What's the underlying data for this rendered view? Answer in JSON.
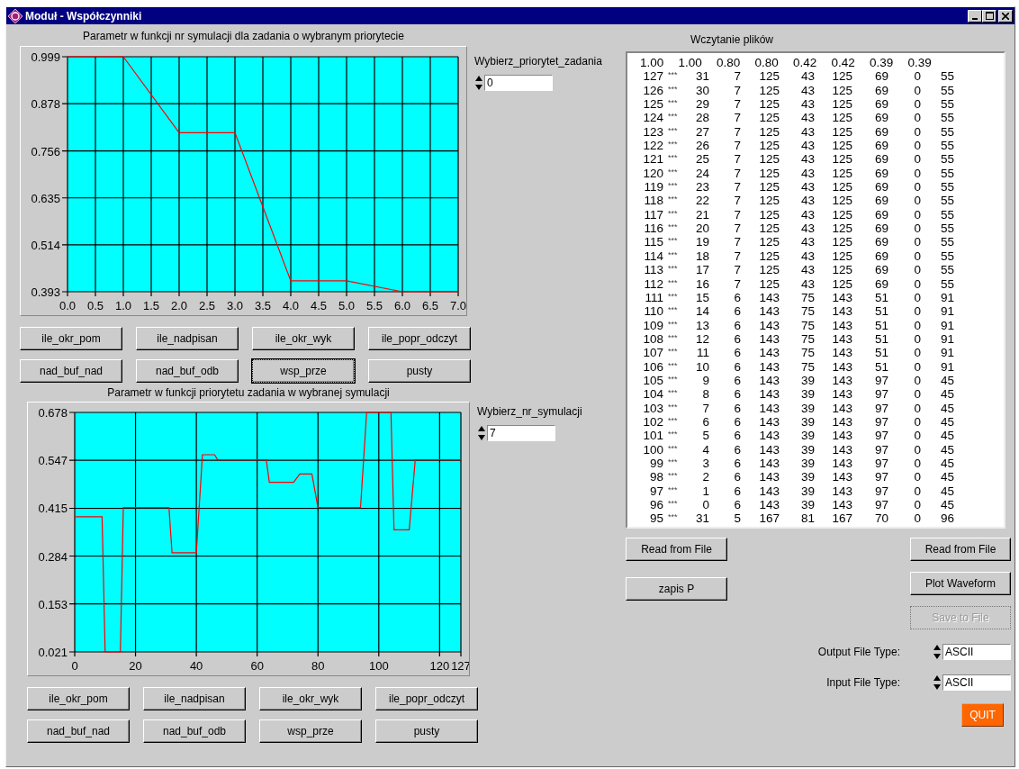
{
  "window": {
    "title": "Moduł - Współczynniki"
  },
  "plots": [
    {
      "title": "Parametr w funkcji nr symulacji dla zadania o wybranym priorytecie",
      "chart_data": {
        "type": "line",
        "x": [
          0,
          1,
          2,
          3,
          4,
          5,
          6,
          7
        ],
        "grid": true,
        "series": [
          {
            "color": "#ff0000",
            "values": [
              0.999,
              0.999,
              0.803,
              0.803,
              0.421,
              0.421,
              0.393,
              0.393
            ]
          }
        ],
        "xlim": [
          0,
          7
        ],
        "ylim": [
          0.393,
          0.999
        ],
        "xticks": [
          {
            "value": 0,
            "label": "0.0"
          },
          {
            "value": 0.5,
            "label": "0.5"
          },
          {
            "value": 1,
            "label": "1.0"
          },
          {
            "value": 1.5,
            "label": "1.5"
          },
          {
            "value": 2,
            "label": "2.0"
          },
          {
            "value": 2.5,
            "label": "2.5"
          },
          {
            "value": 3,
            "label": "3.0"
          },
          {
            "value": 3.5,
            "label": "3.5"
          },
          {
            "value": 4,
            "label": "4.0"
          },
          {
            "value": 4.5,
            "label": "4.5"
          },
          {
            "value": 5,
            "label": "5.0"
          },
          {
            "value": 5.5,
            "label": "5.5"
          },
          {
            "value": 6,
            "label": "6.0"
          },
          {
            "value": 6.5,
            "label": "6.5"
          },
          {
            "value": 7,
            "label": "7.0"
          }
        ],
        "yticks": [
          {
            "value": 0.393,
            "label": "0.393"
          },
          {
            "value": 0.514,
            "label": "0.514"
          },
          {
            "value": 0.635,
            "label": "0.635"
          },
          {
            "value": 0.756,
            "label": "0.756"
          },
          {
            "value": 0.878,
            "label": "0.878"
          },
          {
            "value": 0.999,
            "label": "0.999"
          }
        ]
      },
      "selector": {
        "label": "Wybierz_priorytet_zadania",
        "value": "0"
      },
      "buttons": [
        {
          "label": "ile_okr_pom",
          "focused": false
        },
        {
          "label": "ile_nadpisan",
          "focused": false
        },
        {
          "label": "ile_okr_wyk",
          "focused": false
        },
        {
          "label": "ile_popr_odczyt",
          "focused": false
        },
        {
          "label": "nad_buf_nad",
          "focused": false
        },
        {
          "label": "nad_buf_odb",
          "focused": false
        },
        {
          "label": "wsp_prze",
          "focused": true
        },
        {
          "label": "pusty",
          "focused": false
        }
      ]
    },
    {
      "title": "Parametr w funkcji priorytetu zadania w wybranej symulacji",
      "chart_data": {
        "type": "line",
        "x": [
          0,
          9,
          10,
          15,
          16,
          31,
          32,
          40,
          42,
          46,
          47,
          63,
          64,
          72,
          74,
          78,
          80,
          94,
          96,
          104,
          105,
          110,
          112,
          127
        ],
        "grid": true,
        "series": [
          {
            "color": "#ff0000",
            "values": [
              0.392,
              0.392,
              0.021,
              0.021,
              0.417,
              0.417,
              0.293,
              0.293,
              0.562,
              0.562,
              0.548,
              0.548,
              0.486,
              0.486,
              0.509,
              0.509,
              0.417,
              0.417,
              0.678,
              0.678,
              0.356,
              0.356,
              0.548,
              0.548
            ]
          }
        ],
        "xlim": [
          0,
          127
        ],
        "ylim": [
          0.021,
          0.678
        ],
        "xticks": [
          {
            "value": 0,
            "label": "0"
          },
          {
            "value": 20,
            "label": "20"
          },
          {
            "value": 40,
            "label": "40"
          },
          {
            "value": 60,
            "label": "60"
          },
          {
            "value": 80,
            "label": "80"
          },
          {
            "value": 100,
            "label": "100"
          },
          {
            "value": 120,
            "label": "120"
          },
          {
            "value": 127,
            "label": "127"
          }
        ],
        "yticks": [
          {
            "value": 0.021,
            "label": "0.021"
          },
          {
            "value": 0.153,
            "label": "0.153"
          },
          {
            "value": 0.284,
            "label": "0.284"
          },
          {
            "value": 0.415,
            "label": "0.415"
          },
          {
            "value": 0.547,
            "label": "0.547"
          },
          {
            "value": 0.678,
            "label": "0.678"
          }
        ]
      },
      "selector": {
        "label": "Wybierz_nr_symulacji",
        "value": "7"
      },
      "buttons": [
        {
          "label": "ile_okr_pom",
          "focused": false
        },
        {
          "label": "ile_nadpisan",
          "focused": false
        },
        {
          "label": "ile_okr_wyk",
          "focused": false
        },
        {
          "label": "ile_popr_odczyt",
          "focused": false
        },
        {
          "label": "nad_buf_nad",
          "focused": false
        },
        {
          "label": "nad_buf_odb",
          "focused": false
        },
        {
          "label": "wsp_prze",
          "focused": false
        },
        {
          "label": "pusty",
          "focused": false
        }
      ]
    }
  ],
  "file_list": {
    "title": "Wczytanie plików",
    "header": [
      "1.00",
      "1.00",
      "0.80",
      "0.80",
      "0.42",
      "0.42",
      "0.39",
      "0.39"
    ],
    "rows": [
      {
        "id": "127",
        "marker": "***",
        "cells": [
          "31",
          "7",
          "125",
          "43",
          "125",
          "69",
          "0",
          "55"
        ]
      },
      {
        "id": "126",
        "marker": "***",
        "cells": [
          "30",
          "7",
          "125",
          "43",
          "125",
          "69",
          "0",
          "55"
        ]
      },
      {
        "id": "125",
        "marker": "***",
        "cells": [
          "29",
          "7",
          "125",
          "43",
          "125",
          "69",
          "0",
          "55"
        ]
      },
      {
        "id": "124",
        "marker": "***",
        "cells": [
          "28",
          "7",
          "125",
          "43",
          "125",
          "69",
          "0",
          "55"
        ]
      },
      {
        "id": "123",
        "marker": "***",
        "cells": [
          "27",
          "7",
          "125",
          "43",
          "125",
          "69",
          "0",
          "55"
        ]
      },
      {
        "id": "122",
        "marker": "***",
        "cells": [
          "26",
          "7",
          "125",
          "43",
          "125",
          "69",
          "0",
          "55"
        ]
      },
      {
        "id": "121",
        "marker": "***",
        "cells": [
          "25",
          "7",
          "125",
          "43",
          "125",
          "69",
          "0",
          "55"
        ]
      },
      {
        "id": "120",
        "marker": "***",
        "cells": [
          "24",
          "7",
          "125",
          "43",
          "125",
          "69",
          "0",
          "55"
        ]
      },
      {
        "id": "119",
        "marker": "***",
        "cells": [
          "23",
          "7",
          "125",
          "43",
          "125",
          "69",
          "0",
          "55"
        ]
      },
      {
        "id": "118",
        "marker": "***",
        "cells": [
          "22",
          "7",
          "125",
          "43",
          "125",
          "69",
          "0",
          "55"
        ]
      },
      {
        "id": "117",
        "marker": "***",
        "cells": [
          "21",
          "7",
          "125",
          "43",
          "125",
          "69",
          "0",
          "55"
        ]
      },
      {
        "id": "116",
        "marker": "***",
        "cells": [
          "20",
          "7",
          "125",
          "43",
          "125",
          "69",
          "0",
          "55"
        ]
      },
      {
        "id": "115",
        "marker": "***",
        "cells": [
          "19",
          "7",
          "125",
          "43",
          "125",
          "69",
          "0",
          "55"
        ]
      },
      {
        "id": "114",
        "marker": "***",
        "cells": [
          "18",
          "7",
          "125",
          "43",
          "125",
          "69",
          "0",
          "55"
        ]
      },
      {
        "id": "113",
        "marker": "***",
        "cells": [
          "17",
          "7",
          "125",
          "43",
          "125",
          "69",
          "0",
          "55"
        ]
      },
      {
        "id": "112",
        "marker": "***",
        "cells": [
          "16",
          "7",
          "125",
          "43",
          "125",
          "69",
          "0",
          "55"
        ]
      },
      {
        "id": "111",
        "marker": "***",
        "cells": [
          "15",
          "6",
          "143",
          "75",
          "143",
          "51",
          "0",
          "91"
        ]
      },
      {
        "id": "110",
        "marker": "***",
        "cells": [
          "14",
          "6",
          "143",
          "75",
          "143",
          "51",
          "0",
          "91"
        ]
      },
      {
        "id": "109",
        "marker": "***",
        "cells": [
          "13",
          "6",
          "143",
          "75",
          "143",
          "51",
          "0",
          "91"
        ]
      },
      {
        "id": "108",
        "marker": "***",
        "cells": [
          "12",
          "6",
          "143",
          "75",
          "143",
          "51",
          "0",
          "91"
        ]
      },
      {
        "id": "107",
        "marker": "***",
        "cells": [
          "11",
          "6",
          "143",
          "75",
          "143",
          "51",
          "0",
          "91"
        ]
      },
      {
        "id": "106",
        "marker": "***",
        "cells": [
          "10",
          "6",
          "143",
          "75",
          "143",
          "51",
          "0",
          "91"
        ]
      },
      {
        "id": "105",
        "marker": "***",
        "cells": [
          "9",
          "6",
          "143",
          "39",
          "143",
          "97",
          "0",
          "45"
        ]
      },
      {
        "id": "104",
        "marker": "***",
        "cells": [
          "8",
          "6",
          "143",
          "39",
          "143",
          "97",
          "0",
          "45"
        ]
      },
      {
        "id": "103",
        "marker": "***",
        "cells": [
          "7",
          "6",
          "143",
          "39",
          "143",
          "97",
          "0",
          "45"
        ]
      },
      {
        "id": "102",
        "marker": "***",
        "cells": [
          "6",
          "6",
          "143",
          "39",
          "143",
          "97",
          "0",
          "45"
        ]
      },
      {
        "id": "101",
        "marker": "***",
        "cells": [
          "5",
          "6",
          "143",
          "39",
          "143",
          "97",
          "0",
          "45"
        ]
      },
      {
        "id": "100",
        "marker": "***",
        "cells": [
          "4",
          "6",
          "143",
          "39",
          "143",
          "97",
          "0",
          "45"
        ]
      },
      {
        "id": "99",
        "marker": "***",
        "cells": [
          "3",
          "6",
          "143",
          "39",
          "143",
          "97",
          "0",
          "45"
        ]
      },
      {
        "id": "98",
        "marker": "***",
        "cells": [
          "2",
          "6",
          "143",
          "39",
          "143",
          "97",
          "0",
          "45"
        ]
      },
      {
        "id": "97",
        "marker": "***",
        "cells": [
          "1",
          "6",
          "143",
          "39",
          "143",
          "97",
          "0",
          "45"
        ]
      },
      {
        "id": "96",
        "marker": "***",
        "cells": [
          "0",
          "6",
          "143",
          "39",
          "143",
          "97",
          "0",
          "45"
        ]
      },
      {
        "id": "95",
        "marker": "***",
        "cells": [
          "31",
          "5",
          "167",
          "81",
          "167",
          "70",
          "0",
          "96"
        ]
      }
    ]
  },
  "left_buttons": [
    {
      "label": "Read from File",
      "disabled": false
    },
    {
      "label": "zapis P",
      "disabled": false
    }
  ],
  "right_buttons": [
    {
      "label": "Read from File",
      "disabled": false
    },
    {
      "label": "Plot Waveform",
      "disabled": false
    },
    {
      "label": "Save to File",
      "disabled": true
    }
  ],
  "file_types": [
    {
      "label": "Output File Type:",
      "value": "ASCII"
    },
    {
      "label": "Input File Type:",
      "value": "ASCII"
    }
  ],
  "quit": {
    "label": "QUIT"
  }
}
